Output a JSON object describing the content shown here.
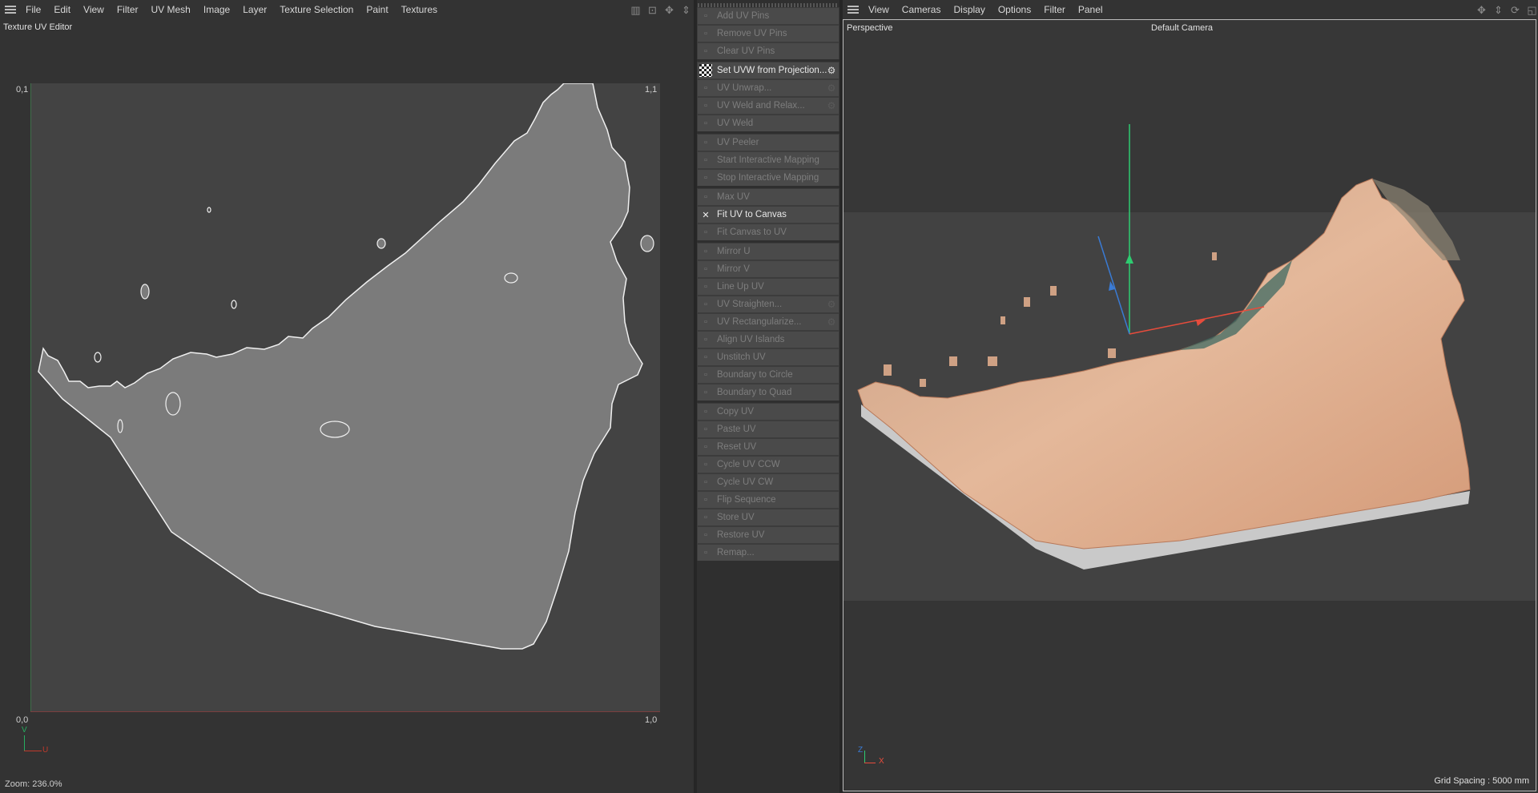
{
  "uv_editor": {
    "menu": [
      "File",
      "Edit",
      "View",
      "Filter",
      "UV Mesh",
      "Image",
      "Layer",
      "Texture Selection",
      "Paint",
      "Textures"
    ],
    "title": "Texture UV Editor",
    "corners": {
      "top_left": "0,1",
      "top_right": "1,1",
      "bottom_left": "0,0",
      "bottom_right": "1,0"
    },
    "axis_v": "V",
    "axis_u": "U",
    "zoom": "Zoom: 236.0%"
  },
  "commands": {
    "items": [
      {
        "label": "Add UV Pins",
        "enabled": false,
        "icon": "pin-add-icon"
      },
      {
        "label": "Remove UV Pins",
        "enabled": false,
        "icon": "pin-remove-icon"
      },
      {
        "label": "Clear UV Pins",
        "enabled": false,
        "icon": "pin-clear-icon"
      },
      {
        "label": "Set UVW from Projection...",
        "enabled": true,
        "icon": "checker-icon",
        "settings": true
      },
      {
        "label": "UV Unwrap...",
        "enabled": false,
        "icon": "unwrap-icon",
        "settings": true
      },
      {
        "label": "UV Weld and Relax...",
        "enabled": false,
        "icon": "weld-relax-icon",
        "settings": true
      },
      {
        "label": "UV Weld",
        "enabled": false,
        "icon": "weld-icon"
      },
      {
        "label": "UV Peeler",
        "enabled": false,
        "icon": "peeler-icon"
      },
      {
        "label": "Start Interactive Mapping",
        "enabled": false,
        "icon": "mapping-start-icon"
      },
      {
        "label": "Stop Interactive Mapping",
        "enabled": false,
        "icon": "mapping-stop-icon"
      },
      {
        "label": "Max UV",
        "enabled": false,
        "icon": "max-uv-icon"
      },
      {
        "label": "Fit UV to Canvas",
        "enabled": true,
        "icon": "fit-uv-icon"
      },
      {
        "label": "Fit Canvas to UV",
        "enabled": false,
        "icon": "fit-canvas-icon"
      },
      {
        "label": "Mirror U",
        "enabled": false,
        "icon": "mirror-u-icon"
      },
      {
        "label": "Mirror V",
        "enabled": false,
        "icon": "mirror-v-icon"
      },
      {
        "label": "Line Up UV",
        "enabled": false,
        "icon": "line-up-icon"
      },
      {
        "label": "UV Straighten...",
        "enabled": false,
        "icon": "straighten-icon",
        "settings": true
      },
      {
        "label": "UV Rectangularize...",
        "enabled": false,
        "icon": "rectangularize-icon",
        "settings": true
      },
      {
        "label": "Align UV Islands",
        "enabled": false,
        "icon": "align-islands-icon"
      },
      {
        "label": "Unstitch UV",
        "enabled": false,
        "icon": "unstitch-icon"
      },
      {
        "label": "Boundary to Circle",
        "enabled": false,
        "icon": "boundary-circle-icon"
      },
      {
        "label": "Boundary to Quad",
        "enabled": false,
        "icon": "boundary-quad-icon"
      },
      {
        "label": "Copy UV",
        "enabled": false,
        "icon": "copy-icon"
      },
      {
        "label": "Paste UV",
        "enabled": false,
        "icon": "paste-icon"
      },
      {
        "label": "Reset UV",
        "enabled": false,
        "icon": "reset-icon"
      },
      {
        "label": "Cycle UV CCW",
        "enabled": false,
        "icon": "cycle-ccw-icon"
      },
      {
        "label": "Cycle UV CW",
        "enabled": false,
        "icon": "cycle-cw-icon"
      },
      {
        "label": "Flip Sequence",
        "enabled": false,
        "icon": "flip-sequence-icon"
      },
      {
        "label": "Store UV",
        "enabled": false,
        "icon": "store-icon"
      },
      {
        "label": "Restore UV",
        "enabled": false,
        "icon": "restore-icon"
      },
      {
        "label": "Remap...",
        "enabled": false,
        "icon": "remap-icon"
      }
    ]
  },
  "viewport": {
    "menu": [
      "View",
      "Cameras",
      "Display",
      "Options",
      "Filter",
      "Panel"
    ],
    "projection": "Perspective",
    "camera": "Default Camera",
    "axis_z": "Z",
    "axis_x": "X",
    "grid_spacing": "Grid Spacing : 5000 mm"
  },
  "colors": {
    "accent": "#e0e0e0",
    "uv_fill": "#7b7b7b",
    "axis_u": "#c0392b",
    "axis_v": "#27ae60",
    "terrain": "#d9a882"
  }
}
